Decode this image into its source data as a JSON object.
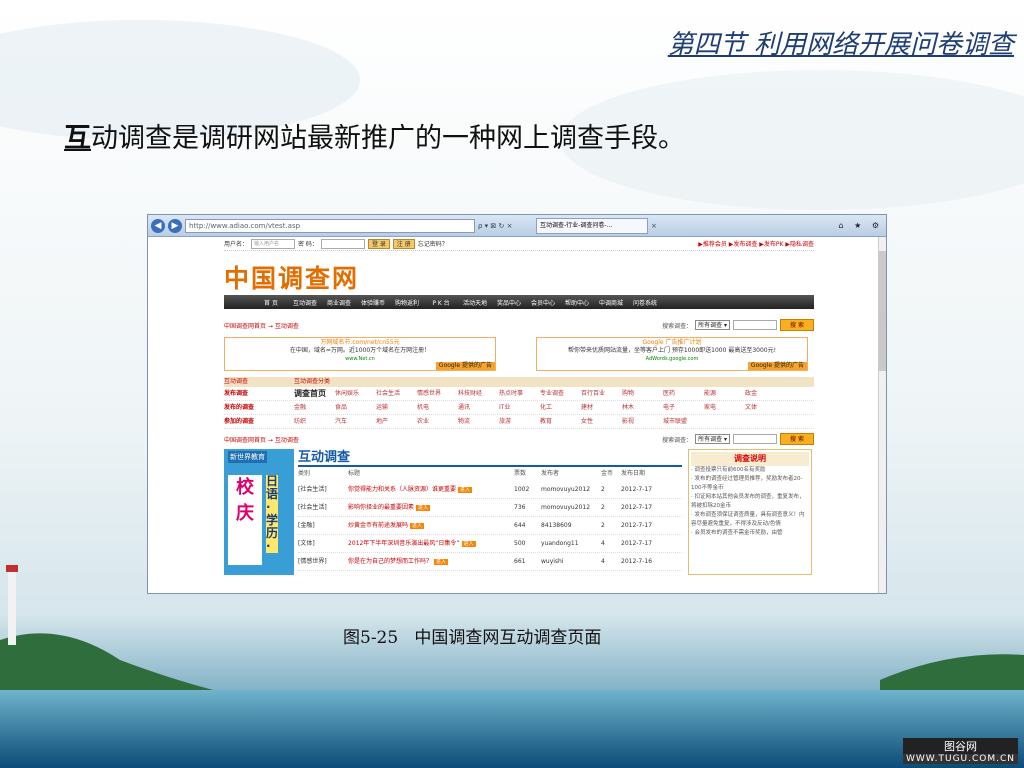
{
  "slide": {
    "title": "第四节 利用网络开展问卷调查",
    "bullet_first": "互",
    "bullet_rest": "动调查是调研网站最新推广的一种网上调查手段。",
    "caption": "图5-25   中国调查网互动调查页面"
  },
  "browser": {
    "address": "http://www.adiao.com/vtest.asp",
    "controls": "ρ ▾ ⊠ ↻ ×",
    "tab_label": "互动调查-行业-调查问卷-...",
    "tab_close": "×",
    "window_icons": "⌂ ★ ⚙",
    "back": "◀",
    "forward": "▶"
  },
  "site": {
    "login": {
      "user_label": "用户名：",
      "user_placeholder": "输入用户名",
      "pass_label": "密 码：",
      "login_btn": "登 录",
      "register_btn": "注 册",
      "forgot": "忘记密码？"
    },
    "top_links": "▶推荐会员 ▶发布调查 ▶发布PK ▶隐私调查",
    "logo": "中国调查网",
    "nav": [
      "首 页",
      "互动调查",
      "商业调查",
      "体验赚币",
      "购物返利",
      "P K 台",
      "活动天地",
      "奖品中心",
      "会员中心",
      "帮助中心",
      "中调商城",
      "问卷系统"
    ],
    "breadcrumb": "中国调查网首页 → 互动调查",
    "search": {
      "label": "搜索调查：",
      "select": "所有调查 ▾",
      "button": "搜 索"
    },
    "ads": [
      {
        "headline": "万网域名节.com/net/cn55元",
        "body": "在中国，域名=万网。近1000万个域名在万网注册！",
        "url": "www.Net.cn",
        "badge": "Google 提供的广告"
      },
      {
        "headline": "Google 广告推广计划",
        "body": "帮你带来优质网站流量，坐等客户上门 预存1000即送1000 最高送至3000元!",
        "url": "AdWords.google.com",
        "badge": "Google 提供的广告"
      }
    ],
    "cat_header": [
      "互动调查",
      "互动调查分类"
    ],
    "cat_rows": [
      {
        "label": "发布调查",
        "items": [
          "调查首页",
          "休闲娱乐",
          "社会生活",
          "情感世界",
          "科技财经",
          "热点时事",
          "专业调查",
          "百行百业",
          "购物",
          "医药",
          "能源",
          "政金"
        ]
      },
      {
        "label": "发布的调查",
        "items": [
          "金融",
          "食品",
          "运输",
          "机电",
          "通讯",
          "IT业",
          "化工",
          "建材",
          "林木",
          "电子",
          "家电",
          "文体"
        ]
      },
      {
        "label": "参加的调查",
        "items": [
          "纺织",
          "汽车",
          "地产",
          "农业",
          "物流",
          "旅游",
          "教育",
          "女性",
          "影视",
          "城市联盟",
          "",
          ""
        ]
      }
    ],
    "breadcrumb2": "中国调查网首页 → 互动调查",
    "banner": {
      "top": "新世界教育",
      "big": "校庆",
      "side": "日语·学历·"
    },
    "section_title": "互动调查",
    "table": {
      "headers": [
        "类别",
        "标题",
        "票数",
        "发布者",
        "金币",
        "发布日期"
      ],
      "rows": [
        [
          "[社会生活]",
          "你觉得能力和关系（人脉资源）谁更重要",
          "1002",
          "momovuyu2012",
          "2",
          "2012-7-17"
        ],
        [
          "[社会生活]",
          "影响你择业的最重要因素",
          "736",
          "momovuyu2012",
          "2",
          "2012-7-17"
        ],
        [
          "[金融]",
          "炒黄金币有前途发展吗",
          "644",
          "84138609",
          "2",
          "2012-7-17"
        ],
        [
          "[文体]",
          "2012年下半年深圳音乐演出最风“日集令”",
          "500",
          "yuandong11",
          "4",
          "2012-7-17"
        ],
        [
          "[情感世界]",
          "你是在为自己的梦想而工作吗？",
          "661",
          "wuyishi",
          "4",
          "2012-7-16"
        ]
      ],
      "tag": "进入"
    },
    "info": {
      "head": "调查说明",
      "lines": [
        "· 调查投票只有前600名有奖励",
        "· 发布的调查经过管理员推荐，奖励发布者20-100不等金币",
        "· 扣证网本站其他会员发布的调查，重复发布，将被扣除20金币",
        "· 发布调查须保证调查质量，具有调查意义！内容尽量避免重复，不得涉及反动/色情",
        "· 会员发布的调查不需金币奖励，由管"
      ]
    }
  },
  "watermark": {
    "line1": "图谷网",
    "line2": "WWW.TUGU.COM.CN"
  },
  "colors": {
    "title": "#1f3c74",
    "logo": "#e46d00",
    "accent": "#c00000",
    "section": "#155aa6"
  }
}
